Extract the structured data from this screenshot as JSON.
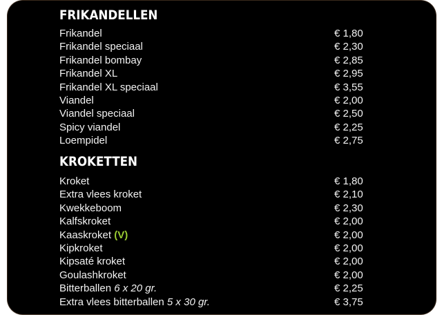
{
  "sections": [
    {
      "title": "FRIKANDELLEN",
      "items": [
        {
          "name": "Frikandel",
          "price": "€ 1,80"
        },
        {
          "name": "Frikandel speciaal",
          "price": "€ 2,30"
        },
        {
          "name": "Frikandel bombay",
          "price": "€ 2,85"
        },
        {
          "name": "Frikandel XL",
          "price": "€ 2,95"
        },
        {
          "name": "Frikandel XL speciaal",
          "price": "€ 3,55"
        },
        {
          "name": "Viandel",
          "price": "€ 2,00"
        },
        {
          "name": "Viandel speciaal",
          "price": "€ 2,50"
        },
        {
          "name": "Spicy viandel",
          "price": "€ 2,25"
        },
        {
          "name": "Loempidel",
          "price": "€ 2,75"
        }
      ]
    },
    {
      "title": "KROKETTEN",
      "items": [
        {
          "name": "Kroket",
          "price": "€ 1,80"
        },
        {
          "name": "Extra vlees kroket",
          "price": "€ 2,10"
        },
        {
          "name": "Kwekkeboom",
          "price": "€ 2,30"
        },
        {
          "name": "Kalfskroket",
          "price": "€ 2,00"
        },
        {
          "name": "Kaaskroket",
          "tag": "(V)",
          "price": "€ 2,00"
        },
        {
          "name": "Kipkroket",
          "price": "€ 2,00"
        },
        {
          "name": "Kipsaté kroket",
          "price": "€ 2,00"
        },
        {
          "name": "Goulashkroket",
          "price": "€ 2,00"
        },
        {
          "name": "Bitterballen",
          "note": "6 x 20 gr.",
          "price": "€ 2,25"
        },
        {
          "name": "Extra vlees bitterballen",
          "note": "5 x 30 gr.",
          "price": "€ 3,75"
        }
      ]
    }
  ],
  "colors": {
    "background": "#000000",
    "text": "#f2f2f2",
    "vegetarian": "#9acd32"
  }
}
